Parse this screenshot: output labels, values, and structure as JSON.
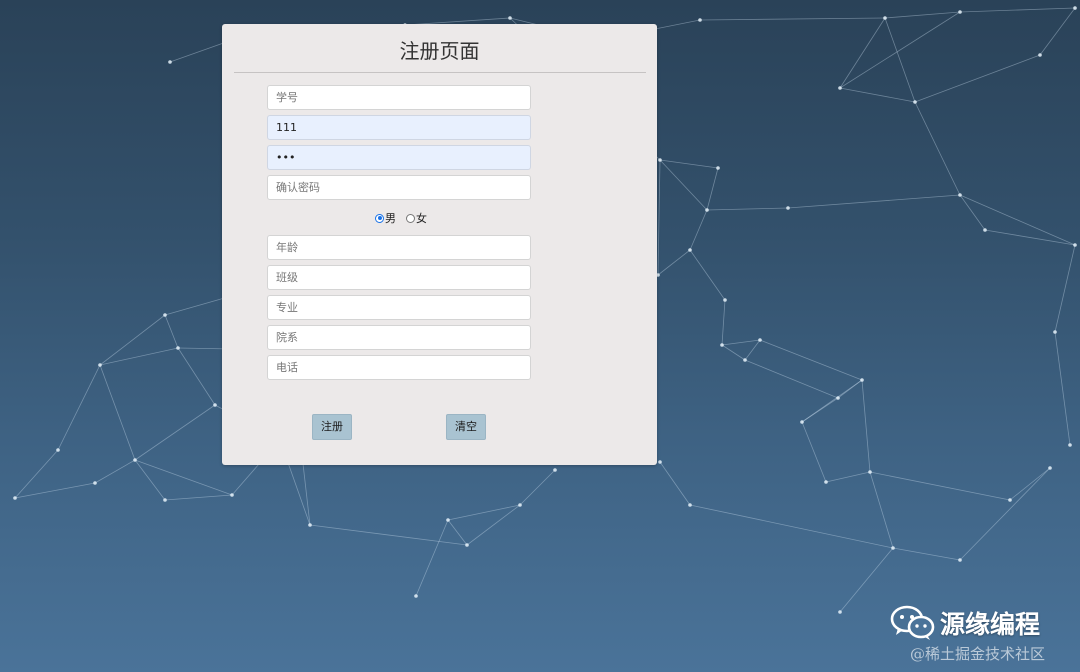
{
  "form": {
    "title": "注册页面",
    "fields": {
      "student_id": {
        "placeholder": "学号",
        "value": ""
      },
      "username": {
        "placeholder": "",
        "value": "111"
      },
      "password": {
        "placeholder": "",
        "value": "111"
      },
      "confirm_password": {
        "placeholder": "确认密码",
        "value": ""
      },
      "age": {
        "placeholder": "年龄",
        "value": ""
      },
      "class_name": {
        "placeholder": "班级",
        "value": ""
      },
      "major": {
        "placeholder": "专业",
        "value": ""
      },
      "department": {
        "placeholder": "院系",
        "value": ""
      },
      "phone": {
        "placeholder": "电话",
        "value": ""
      }
    },
    "gender": {
      "options": [
        {
          "label": "男",
          "checked": true
        },
        {
          "label": "女",
          "checked": false
        }
      ]
    },
    "buttons": {
      "register": "注册",
      "clear": "清空"
    }
  },
  "watermark": {
    "brand": "源缘编程",
    "site": "@稀土掘金技术社区",
    "icon": "wechat-icon"
  },
  "colors": {
    "panel_bg": "#ece9e9",
    "button_bg": "#a9c3d1",
    "autofill_bg": "#e8f0fe",
    "radio_accent": "#1a73e8"
  }
}
